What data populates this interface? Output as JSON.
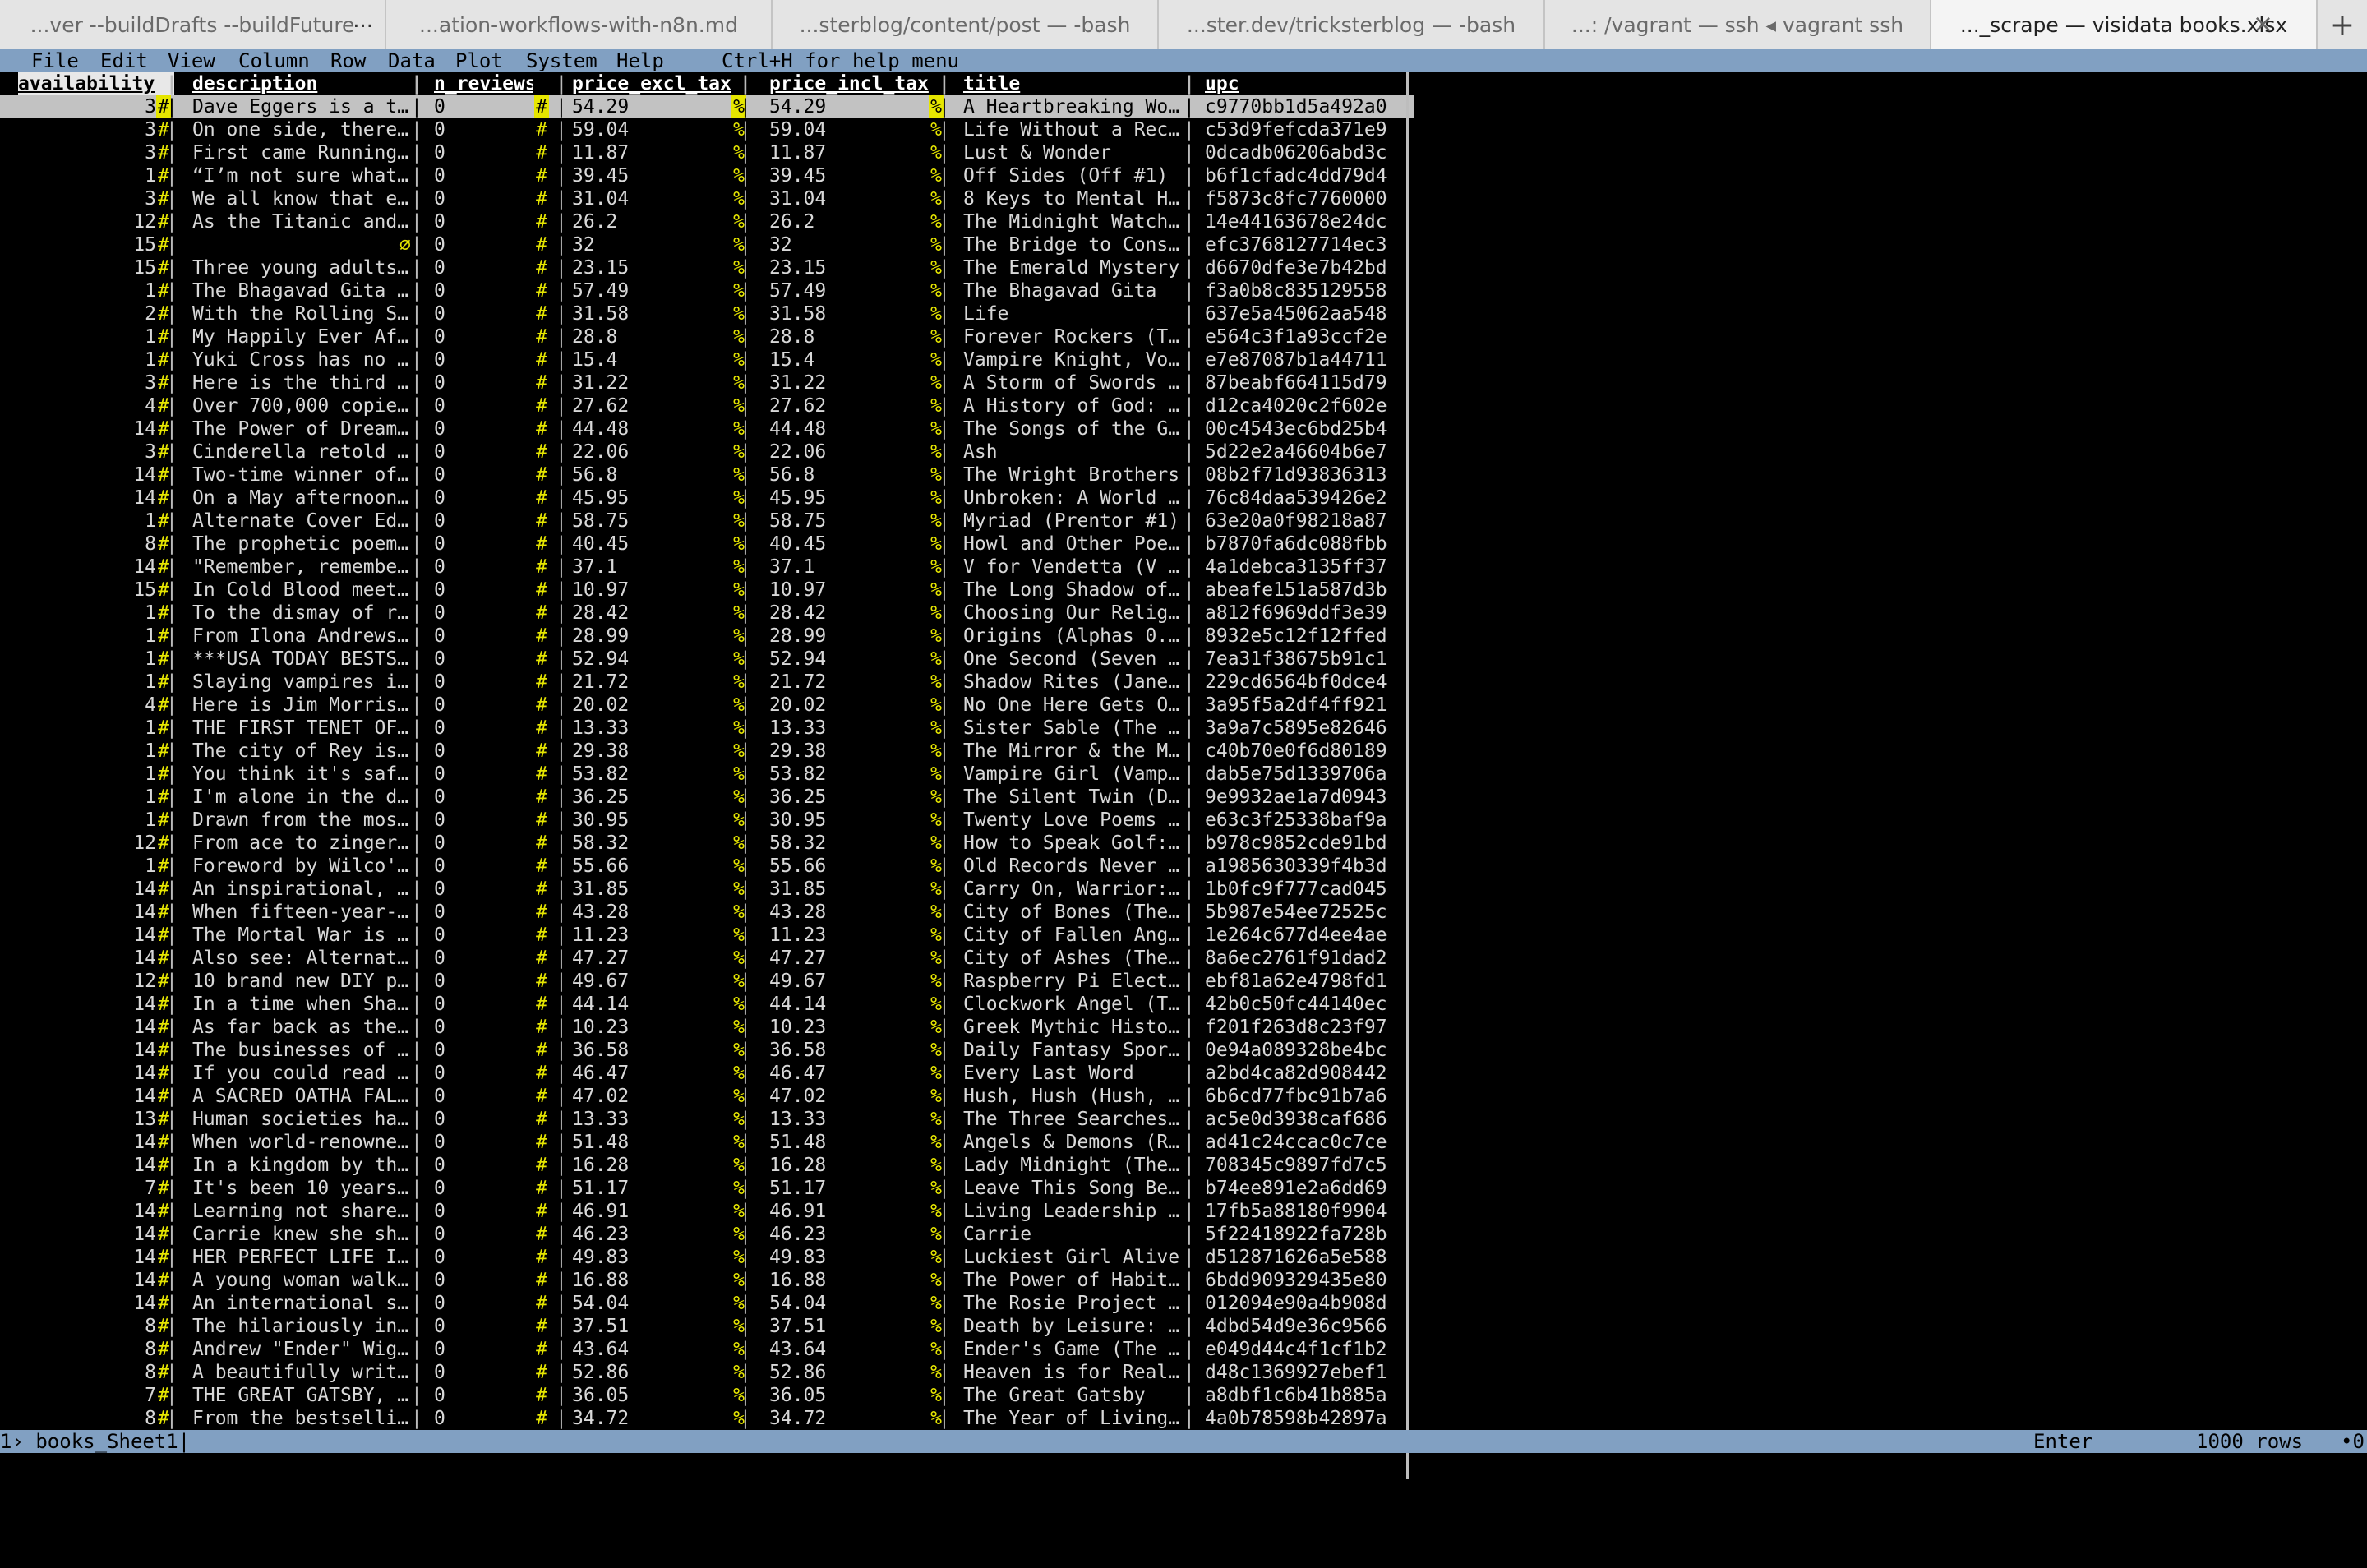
{
  "tabs": [
    {
      "label": "...ver --buildDrafts --buildFuture",
      "more": "...",
      "active": false
    },
    {
      "label": "...ation-workflows-with-n8n.md",
      "active": false
    },
    {
      "label": "...sterblog/content/post — -bash",
      "active": false
    },
    {
      "label": "...ster.dev/tricksterblog — -bash",
      "active": false
    },
    {
      "label": "...: /vagrant — ssh ◂ vagrant ssh",
      "active": false
    },
    {
      "label": "..._scrape — visidata books.xlsx",
      "active": true
    }
  ],
  "tab_close": "×",
  "new_tab": "+",
  "menu": {
    "items": [
      "File",
      "Edit",
      "View",
      "Column",
      "Row",
      "Data",
      "Plot",
      "System",
      "Help"
    ],
    "hint": "Ctrl+H for help menu"
  },
  "columns": [
    "availability",
    "description",
    "n_reviews",
    "price_excl_tax",
    "price_incl_tax",
    "title",
    "upc"
  ],
  "type_marks": {
    "int": "#",
    "float": "%"
  },
  "null_mark": "∅",
  "rows": [
    [
      "3",
      "Dave Eggers is a t…",
      "0",
      "54.29",
      "54.29",
      "A Heartbreaking Wo…",
      "c9770bb1d5a492a0"
    ],
    [
      "3",
      "On one side, there…",
      "0",
      "59.04",
      "59.04",
      "Life Without a Rec…",
      "c53d9fefcda371e9"
    ],
    [
      "3",
      "First came Running…",
      "0",
      "11.87",
      "11.87",
      "Lust & Wonder",
      "0dcadb06206abd3c"
    ],
    [
      "1",
      "“I’m not sure what…",
      "0",
      "39.45",
      "39.45",
      "Off Sides (Off #1)",
      "b6f1cfadc4dd79d4"
    ],
    [
      "3",
      "We all know that e…",
      "0",
      "31.04",
      "31.04",
      "8 Keys to Mental H…",
      "f5873c8fc7760000"
    ],
    [
      "12",
      "As the Titanic and…",
      "0",
      "26.2",
      "26.2",
      "The Midnight Watch…",
      "14e44163678e24dc"
    ],
    [
      "15",
      "",
      "0",
      "32",
      "32",
      "The Bridge to Cons…",
      "efc3768127714ec3"
    ],
    [
      "15",
      "Three young adults…",
      "0",
      "23.15",
      "23.15",
      "The Emerald Mystery",
      "d6670dfe3e7b42bd"
    ],
    [
      "1",
      "The Bhagavad Gita …",
      "0",
      "57.49",
      "57.49",
      "The Bhagavad Gita",
      "f3a0b8c835129558"
    ],
    [
      "2",
      "With the Rolling S…",
      "0",
      "31.58",
      "31.58",
      "Life",
      "637e5a45062aa548"
    ],
    [
      "1",
      "My Happily Ever Af…",
      "0",
      "28.8",
      "28.8",
      "Forever Rockers (T…",
      "e564c3f1a93ccf2e"
    ],
    [
      "1",
      "Yuki Cross has no …",
      "0",
      "15.4",
      "15.4",
      "Vampire Knight, Vo…",
      "e7e87087b1a44711"
    ],
    [
      "3",
      "Here is the third …",
      "0",
      "31.22",
      "31.22",
      "A Storm of Swords …",
      "87beabf664115d79"
    ],
    [
      "4",
      "Over 700,000 copie…",
      "0",
      "27.62",
      "27.62",
      "A History of God: …",
      "d12ca4020c2f602e"
    ],
    [
      "14",
      "The Power of Dream…",
      "0",
      "44.48",
      "44.48",
      "The Songs of the G…",
      "00c4543ec6bd25b4"
    ],
    [
      "3",
      "Cinderella retold …",
      "0",
      "22.06",
      "22.06",
      "Ash",
      "5d22e2a46604b6e7"
    ],
    [
      "14",
      "Two-time winner of…",
      "0",
      "56.8",
      "56.8",
      "The Wright Brothers",
      "08b2f71d93836313"
    ],
    [
      "14",
      "On a May afternoon…",
      "0",
      "45.95",
      "45.95",
      "Unbroken: A World …",
      "76c84daa539426e2"
    ],
    [
      "1",
      "Alternate Cover Ed…",
      "0",
      "58.75",
      "58.75",
      "Myriad (Prentor #1)",
      "63e20a0f98218a87"
    ],
    [
      "8",
      "The prophetic poem…",
      "0",
      "40.45",
      "40.45",
      "Howl and Other Poe…",
      "b7870fa6dc088fbb"
    ],
    [
      "14",
      "\"Remember, remembe…",
      "0",
      "37.1",
      "37.1",
      "V for Vendetta (V …",
      "4a1debca3135ff37"
    ],
    [
      "15",
      "In Cold Blood meet…",
      "0",
      "10.97",
      "10.97",
      "The Long Shadow of…",
      "abeafe151a587d3b"
    ],
    [
      "1",
      "To the dismay of r…",
      "0",
      "28.42",
      "28.42",
      "Choosing Our Relig…",
      "a812f6969ddf3e39"
    ],
    [
      "1",
      "From Ilona Andrews…",
      "0",
      "28.99",
      "28.99",
      "Origins (Alphas 0.…",
      "8932e5c12f12ffed"
    ],
    [
      "1",
      "***USA TODAY BESTS…",
      "0",
      "52.94",
      "52.94",
      "One Second (Seven …",
      "7ea31f38675b91c1"
    ],
    [
      "1",
      "Slaying vampires i…",
      "0",
      "21.72",
      "21.72",
      "Shadow Rites (Jane…",
      "229cd6564bf0dce4"
    ],
    [
      "4",
      "Here is Jim Morris…",
      "0",
      "20.02",
      "20.02",
      "No One Here Gets O…",
      "3a95f5a2df4ff921"
    ],
    [
      "1",
      "THE FIRST TENET OF…",
      "0",
      "13.33",
      "13.33",
      "Sister Sable (The …",
      "3a9a7c5895e82646"
    ],
    [
      "1",
      "The city of Rey is…",
      "0",
      "29.38",
      "29.38",
      "The Mirror & the M…",
      "c40b70e0f6d80189"
    ],
    [
      "1",
      "You think it's saf…",
      "0",
      "53.82",
      "53.82",
      "Vampire Girl (Vamp…",
      "dab5e75d1339706a"
    ],
    [
      "1",
      "I'm alone in the d…",
      "0",
      "36.25",
      "36.25",
      "The Silent Twin (D…",
      "9e9932ae1a7d0943"
    ],
    [
      "1",
      "Drawn from the mos…",
      "0",
      "30.95",
      "30.95",
      "Twenty Love Poems …",
      "e63c3f25338baf9a"
    ],
    [
      "12",
      "From ace to zinger…",
      "0",
      "58.32",
      "58.32",
      "How to Speak Golf:…",
      "b978c9852cde91bd"
    ],
    [
      "1",
      "Foreword by Wilco'…",
      "0",
      "55.66",
      "55.66",
      "Old Records Never …",
      "a1985630339f4b3d"
    ],
    [
      "14",
      "An inspirational, …",
      "0",
      "31.85",
      "31.85",
      "Carry On, Warrior:…",
      "1b0fc9f777cad045"
    ],
    [
      "14",
      "When fifteen-year-…",
      "0",
      "43.28",
      "43.28",
      "City of Bones (The…",
      "5b987e54ee72525c"
    ],
    [
      "14",
      "The Mortal War is …",
      "0",
      "11.23",
      "11.23",
      "City of Fallen Ang…",
      "1e264c677d4ee4ae"
    ],
    [
      "14",
      "Also see: Alternat…",
      "0",
      "47.27",
      "47.27",
      "City of Ashes (The…",
      "8a6ec2761f91dad2"
    ],
    [
      "12",
      "10 brand new DIY p…",
      "0",
      "49.67",
      "49.67",
      "Raspberry Pi Elect…",
      "ebf81a62e4798fd1"
    ],
    [
      "14",
      "In a time when Sha…",
      "0",
      "44.14",
      "44.14",
      "Clockwork Angel (T…",
      "42b0c50fc44140ec"
    ],
    [
      "14",
      "As far back as the…",
      "0",
      "10.23",
      "10.23",
      "Greek Mythic Histo…",
      "f201f263d8c23f97"
    ],
    [
      "14",
      "The businesses of …",
      "0",
      "36.58",
      "36.58",
      "Daily Fantasy Spor…",
      "0e94a089328be4bc"
    ],
    [
      "14",
      "If you could read …",
      "0",
      "46.47",
      "46.47",
      "Every Last Word",
      "a2bd4ca82d908442"
    ],
    [
      "14",
      "A SACRED OATHA FAL…",
      "0",
      "47.02",
      "47.02",
      "Hush, Hush (Hush, …",
      "6b6cd77fbc91b7a6"
    ],
    [
      "13",
      "Human societies ha…",
      "0",
      "13.33",
      "13.33",
      "The Three Searches…",
      "ac5e0d3938caf686"
    ],
    [
      "14",
      "When world-renowne…",
      "0",
      "51.48",
      "51.48",
      "Angels & Demons (R…",
      "ad41c24ccac0c7ce"
    ],
    [
      "14",
      "In a kingdom by th…",
      "0",
      "16.28",
      "16.28",
      "Lady Midnight (The…",
      "708345c9897fd7c5"
    ],
    [
      "7",
      "It's been 10 years…",
      "0",
      "51.17",
      "51.17",
      "Leave This Song Be…",
      "b74ee891e2a6dd69"
    ],
    [
      "14",
      "Learning not share…",
      "0",
      "46.91",
      "46.91",
      "Living Leadership …",
      "17fb5a88180f9904"
    ],
    [
      "14",
      "Carrie knew she sh…",
      "0",
      "46.23",
      "46.23",
      "Carrie",
      "5f22418922fa728b"
    ],
    [
      "14",
      "HER PERFECT LIFE I…",
      "0",
      "49.83",
      "49.83",
      "Luckiest Girl Alive",
      "d512871626a5e588"
    ],
    [
      "14",
      "A young woman walk…",
      "0",
      "16.88",
      "16.88",
      "The Power of Habit…",
      "6bdd909329435e80"
    ],
    [
      "14",
      "An international s…",
      "0",
      "54.04",
      "54.04",
      "The Rosie Project …",
      "012094e90a4b908d"
    ],
    [
      "8",
      "The hilariously in…",
      "0",
      "37.51",
      "37.51",
      "Death by Leisure: …",
      "4dbd54d9e36c9566"
    ],
    [
      "8",
      "Andrew \"Ender\" Wig…",
      "0",
      "43.64",
      "43.64",
      "Ender's Game (The …",
      "e049d44c4f1cf1b2"
    ],
    [
      "8",
      "A beautifully writ…",
      "0",
      "52.86",
      "52.86",
      "Heaven is for Real…",
      "d48c1369927ebef1"
    ],
    [
      "7",
      "THE GREAT GATSBY, …",
      "0",
      "36.05",
      "36.05",
      "The Great Gatsby",
      "a8dbf1c6b41b885a"
    ],
    [
      "8",
      "From the bestselli…",
      "0",
      "34.72",
      "34.72",
      "The Year of Living…",
      "4a0b78598b42897a"
    ]
  ],
  "status": {
    "sheet": "1› books_Sheet1|",
    "key": "Enter",
    "rows": "1000 rows",
    "indicator": "•0"
  }
}
